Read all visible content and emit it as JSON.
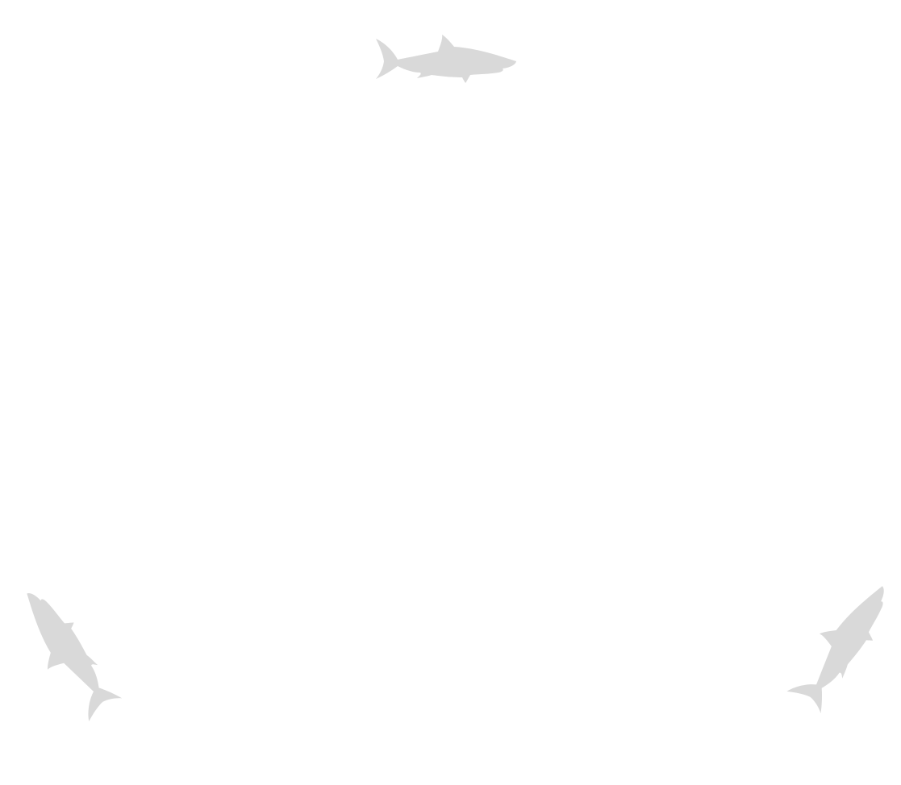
{
  "scene": {
    "background_color": "#ffffff",
    "shark_color": "#d9d9d9",
    "sharks": [
      {
        "icon": "shark-icon",
        "position": "top-center",
        "heading": "right"
      },
      {
        "icon": "shark-icon",
        "position": "bottom-left",
        "heading": "up-left"
      },
      {
        "icon": "shark-icon",
        "position": "bottom-right",
        "heading": "down-left"
      }
    ]
  }
}
